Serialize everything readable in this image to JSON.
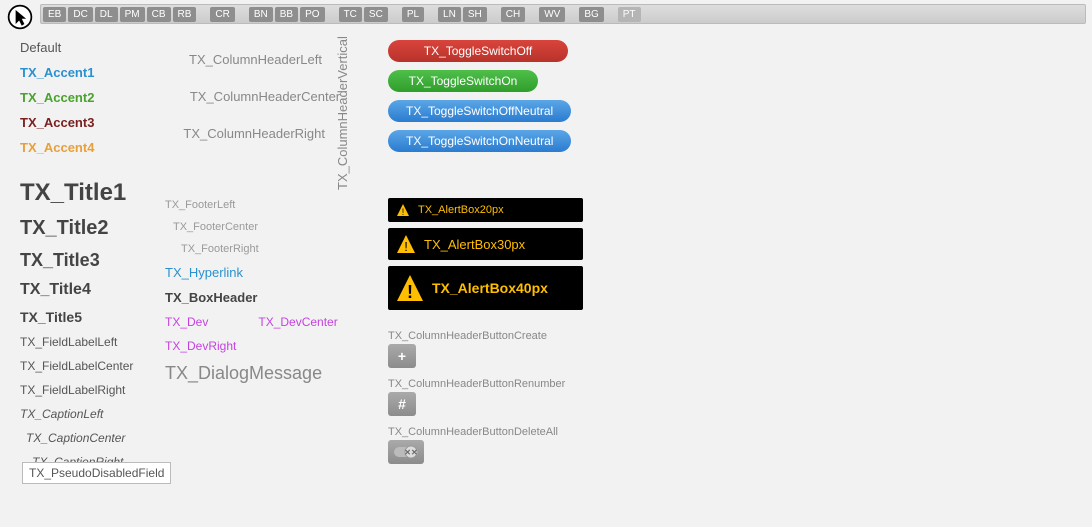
{
  "cursorIcon": "cursor-arrow",
  "tabs": [
    [
      "EB",
      "DC",
      "DL",
      "PM",
      "CB",
      "RB"
    ],
    [
      "CR"
    ],
    [
      "BN",
      "BB",
      "PO"
    ],
    [
      "TC",
      "SC"
    ],
    [
      "PL"
    ],
    [
      "LN",
      "SH"
    ],
    [
      "CH"
    ],
    [
      "WV"
    ],
    [
      "BG"
    ],
    [
      "PT"
    ]
  ],
  "col1": {
    "default": "Default",
    "accent1": "TX_Accent1",
    "accent2": "TX_Accent2",
    "accent3": "TX_Accent3",
    "accent4": "TX_Accent4",
    "title1": "TX_Title1",
    "title2": "TX_Title2",
    "title3": "TX_Title3",
    "title4": "TX_Title4",
    "title5": "TX_Title5",
    "fieldLabelLeft": "TX_FieldLabelLeft",
    "fieldLabelCenter": "TX_FieldLabelCenter",
    "fieldLabelRight": "TX_FieldLabelRight",
    "captionLeft": "TX_CaptionLeft",
    "captionCenter": "TX_CaptionCenter",
    "captionRight": "TX_CaptionRight",
    "pseudoDisabled": "TX_PseudoDisabledField"
  },
  "col2": {
    "colHeaderLeft": "TX_ColumnHeaderLeft",
    "colHeaderCenter": "TX_ColumnHeaderCenter",
    "colHeaderRight": "TX_ColumnHeaderRight",
    "footerLeft": "TX_FooterLeft",
    "footerCenter": "TX_FooterCenter",
    "footerRight": "TX_FooterRight",
    "hyperlink": "TX_Hyperlink",
    "boxHeader": "TX_BoxHeader",
    "dev": "TX_Dev",
    "devCenter": "TX_DevCenter",
    "devRight": "TX_DevRight",
    "dialogMessage": "TX_DialogMessage"
  },
  "col3": {
    "vertical": "TX_ColumnHeaderVertical"
  },
  "col4": {
    "toggleOff": "TX_ToggleSwitchOff",
    "toggleOn": "TX_ToggleSwitchOn",
    "toggleOffNeutral": "TX_ToggleSwitchOffNeutral",
    "toggleOnNeutral": "TX_ToggleSwitchOnNeutral",
    "alert20": "TX_AlertBox20px",
    "alert30": "TX_AlertBox30px",
    "alert40": "TX_AlertBox40px",
    "colBtnCreate": "TX_ColumnHeaderButtonCreate",
    "colBtnRenumber": "TX_ColumnHeaderButtonRenumber",
    "colBtnDeleteAll": "TX_ColumnHeaderButtonDeleteAll",
    "plus": "+",
    "hash": "#"
  }
}
